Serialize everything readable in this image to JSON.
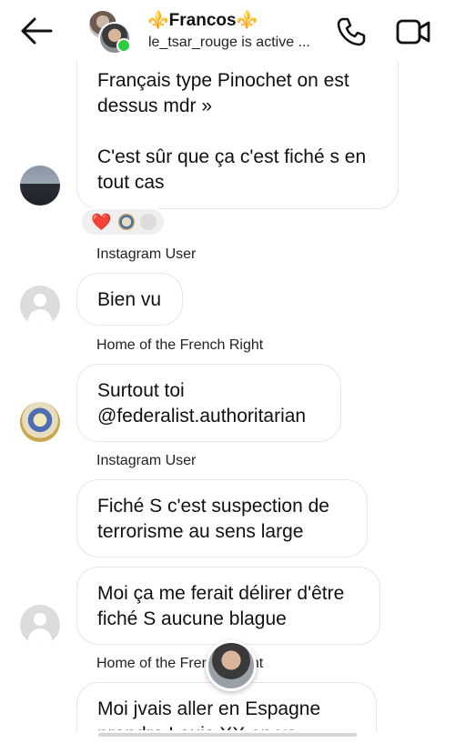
{
  "header": {
    "back_icon": "arrow-left-icon",
    "title": "Francos",
    "title_emoji": "⚜️",
    "subtitle": "le_tsar_rouge is active ...",
    "phone_icon": "phone-icon",
    "video_icon": "video-camera-icon",
    "online_color": "#2ecc40"
  },
  "messages": [
    {
      "sender": "",
      "text": "Français type Pinochet on est dessus mdr »\n\nC'est sûr que ça c'est fiché s en tout cas",
      "avatar": "dark",
      "reactions": [
        "❤️",
        "avatar",
        "avatar"
      ]
    },
    {
      "sender": "Instagram User",
      "text": "Bien vu",
      "avatar": "default"
    },
    {
      "sender": "Home of the French Right",
      "text": "Surtout toi @federalist.authoritarian",
      "avatar": "saint"
    },
    {
      "sender": "Instagram User",
      "text": "Fiché S c'est suspection de terrorisme au sens large",
      "avatar": ""
    },
    {
      "sender": "",
      "text": "Moi ça me ferait délirer d'être fiché S aucune blague",
      "avatar": "default"
    },
    {
      "sender": "Home of the French Right",
      "text": "Moi jvais aller en Espagne prendre Louis XX en vo",
      "avatar": ""
    }
  ]
}
